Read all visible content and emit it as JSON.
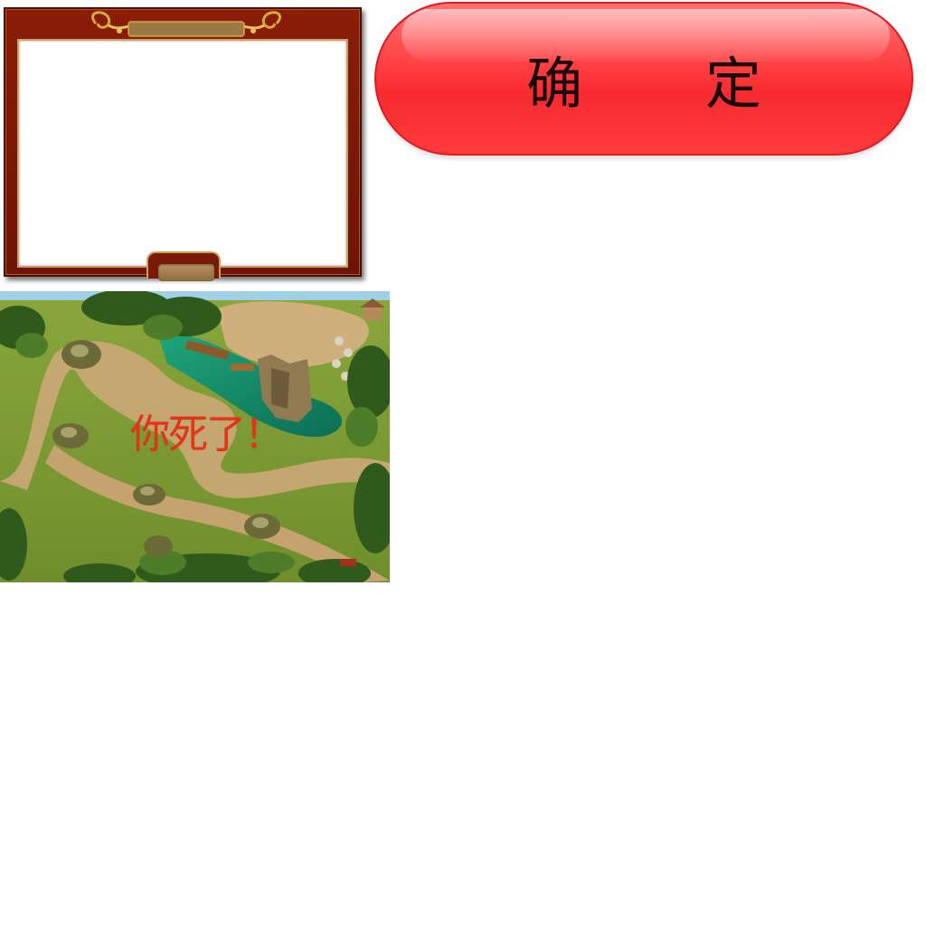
{
  "dialog": {
    "frame_color": "#7a1905",
    "trim_color": "#c9a25a",
    "content_color": "#ffffff"
  },
  "confirm_button": {
    "label": "确 定",
    "color": "#ff3b3e"
  },
  "game": {
    "status_message": "你死了！",
    "status_color": "#e63217"
  }
}
